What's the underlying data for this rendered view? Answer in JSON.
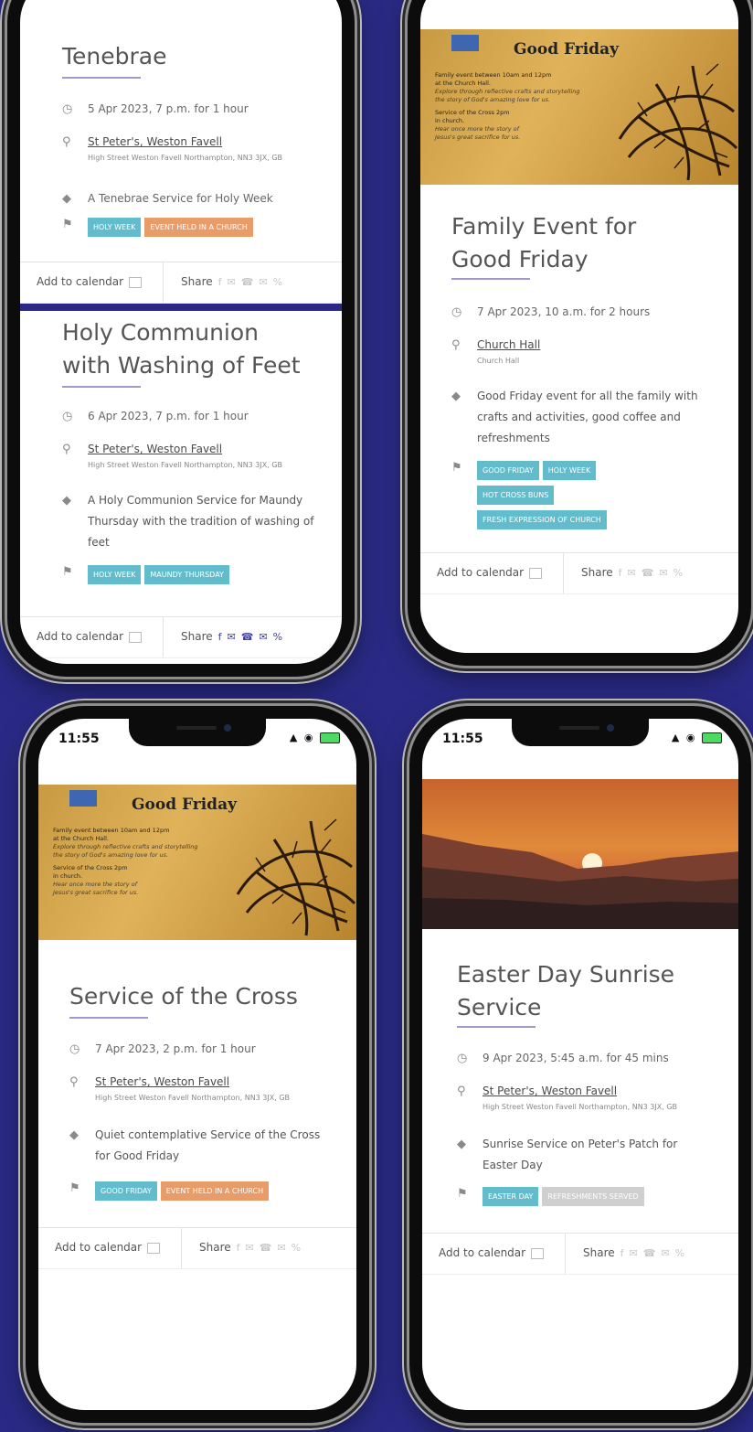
{
  "status_time": "11:55",
  "banner": {
    "heading": "Good Friday",
    "lines": [
      "Family event between 10am and 12pm",
      "at the Church Hall.",
      "Explore through reflective crafts and storytelling",
      "the story of God's amazing love for us.",
      "Service of the Cross 2pm",
      "in church.",
      "Hear once more the story of",
      "Jesus's great sacrifice for us."
    ]
  },
  "footer": {
    "add_label": "Add to calendar",
    "share_label": "Share",
    "share_icons": [
      "f",
      "✉",
      "☎",
      "✉",
      "%"
    ]
  },
  "colors": {
    "background": "#2a2a86",
    "tag_blue": "#62bccc",
    "tag_orange": "#e79c6a",
    "tag_grey": "#cfcfcf",
    "underline": "#a597c9"
  },
  "p1": {
    "tenebrae": {
      "title": "Tenebrae",
      "date": "5 Apr 2023, 7 p.m. for 1 hour",
      "venue": "St Peter's, Weston Favell",
      "address": "High Street Weston Favell Northampton, NN3 3JX, GB",
      "description": "A Tenebrae Service for Holy Week",
      "tags": [
        "HOLY WEEK",
        "EVENT HELD IN A CHURCH"
      ]
    },
    "holy": {
      "title_lines": [
        "Holy Communion",
        "with Washing of Feet"
      ],
      "date": "6 Apr 2023, 7 p.m. for 1 hour",
      "venue": "St Peter's, Weston Favell",
      "address": "High Street Weston Favell Northampton, NN3 3JX, GB",
      "description_lines": [
        "A Holy Communion Service for Maundy",
        "Thursday with the tradition of washing of",
        "feet"
      ],
      "tags": [
        "HOLY WEEK",
        "MAUNDY THURSDAY"
      ]
    }
  },
  "p2": {
    "title_lines": [
      "Family Event for",
      "Good Friday"
    ],
    "date": "7 Apr 2023, 10 a.m. for 2 hours",
    "venue": "Church Hall",
    "address": "Church Hall",
    "description_lines": [
      "Good Friday event for all the family with",
      "crafts and activities, good coffee and",
      "refreshments"
    ],
    "tags": [
      "GOOD FRIDAY",
      "HOLY WEEK",
      "HOT CROSS BUNS",
      "FRESH EXPRESSION OF CHURCH"
    ]
  },
  "p3": {
    "title": "Service of the Cross",
    "date": "7 Apr 2023, 2 p.m. for 1 hour",
    "venue": "St Peter's, Weston Favell",
    "address": "High Street Weston Favell Northampton, NN3 3JX, GB",
    "description_lines": [
      "Quiet contemplative Service of the Cross",
      "for Good Friday"
    ],
    "tags": [
      "GOOD FRIDAY",
      "EVENT HELD IN A CHURCH"
    ]
  },
  "p4": {
    "title_lines": [
      "Easter Day Sunrise",
      "Service"
    ],
    "date": "9 Apr 2023, 5:45 a.m. for 45 mins",
    "venue": "St Peter's, Weston Favell",
    "address": "High Street Weston Favell Northampton, NN3 3JX, GB",
    "description_lines": [
      "Sunrise Service on Peter's Patch for",
      "Easter Day"
    ],
    "tags": [
      "EASTER DAY",
      "REFRESHMENTS SERVED"
    ]
  }
}
